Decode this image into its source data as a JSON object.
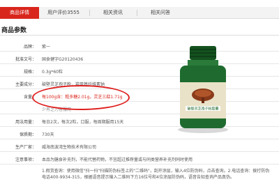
{
  "tabs": [
    {
      "label": "商品详情",
      "active": true
    },
    {
      "label": "用户评价3555",
      "active": false
    },
    {
      "label": "相关资讯",
      "active": false
    },
    {
      "label": "相关问答",
      "active": false
    }
  ],
  "section": {
    "title": "商品参数"
  },
  "params": [
    {
      "label": "品牌：",
      "value": "紫一"
    },
    {
      "label": "批准文号：",
      "value": "国食健字G20120436"
    },
    {
      "label": "规格：",
      "value": "0.3g*60粒"
    },
    {
      "label": "主要成分：",
      "value": "破壁灵芝孢子粉，羧甲基纤维素钠"
    },
    {
      "label": "含量：",
      "value": "每100g含：粗多糖2.01g，灵芝三萜1.71g"
    },
    {
      "label": "",
      "value": "少有乏力者服用"
    },
    {
      "label": "用法用量：",
      "value": "每日2次，每次2粒，口服，每周期服用15天"
    },
    {
      "label": "保质期：",
      "value": "730天"
    },
    {
      "label": "生产厂家：",
      "value": "威海南波湾生物技术有限公司"
    },
    {
      "label": "注意事项：",
      "value": "本品为膳食补充剂，不能代替药物，不宜超过推荐量或与同类营养补充剂同时使用"
    }
  ],
  "footer_note": "1.假货查询：使用微信\"扫一扫\"扫描防伪标签上的\"二维码\"，刮开涂层，输入4位防伪码，点击查询。2.电话查询：拨打防伪电话400-9934-315，根据语音提示输入二维码下方16位号和4位涂层防伪码，语音告知查询产品真伪。",
  "product_image": {
    "label_text": "破壁灵芝孢子粉胶囊",
    "colors": {
      "bottle": "#1f6b2f",
      "cap": "#14521f",
      "band": "#e9e2c8",
      "shadow": "#d8d8d8"
    }
  },
  "colors": {
    "accent": "#d9261c",
    "annotation": "#e02020"
  }
}
